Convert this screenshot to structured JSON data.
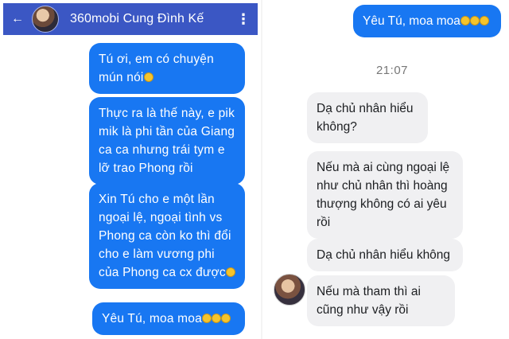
{
  "left": {
    "title": "360mobi Cung Đình Kế",
    "back_icon": "back-arrow-icon",
    "more_icon": "more-vertical-icon",
    "messages": [
      {
        "text": "Tú ơi, em có chuyện mún nói"
      },
      {
        "text": "Thực ra là thế này, e pik mik là phi tần của Giang ca ca nhưng trái tym e lỡ trao Phong rồi"
      },
      {
        "text": "Xin Tú cho e một lần ngoại lệ, ngoại tình vs Phong ca còn ko thì đổi cho e làm vương phi của Phong ca cx được"
      },
      {
        "text": "Yêu Tú, moa moa"
      }
    ]
  },
  "right": {
    "outgoing": "Yêu Tú, moa moa",
    "timestamp": "21:07",
    "messages": [
      {
        "text": "Dạ chủ nhân hiểu không?"
      },
      {
        "text": "Nếu mà ai cùng ngoại lệ như chủ nhân thì hoàng thượng không có ai yêu rồi"
      },
      {
        "text": "Dạ chủ nhân hiểu không"
      },
      {
        "text": "Nếu mà tham thì ai cũng như vậy rồi"
      }
    ]
  },
  "colors": {
    "appbar": "#3b57c4",
    "outgoing_bubble": "#1877f2",
    "incoming_bubble": "#f0f0f2"
  }
}
